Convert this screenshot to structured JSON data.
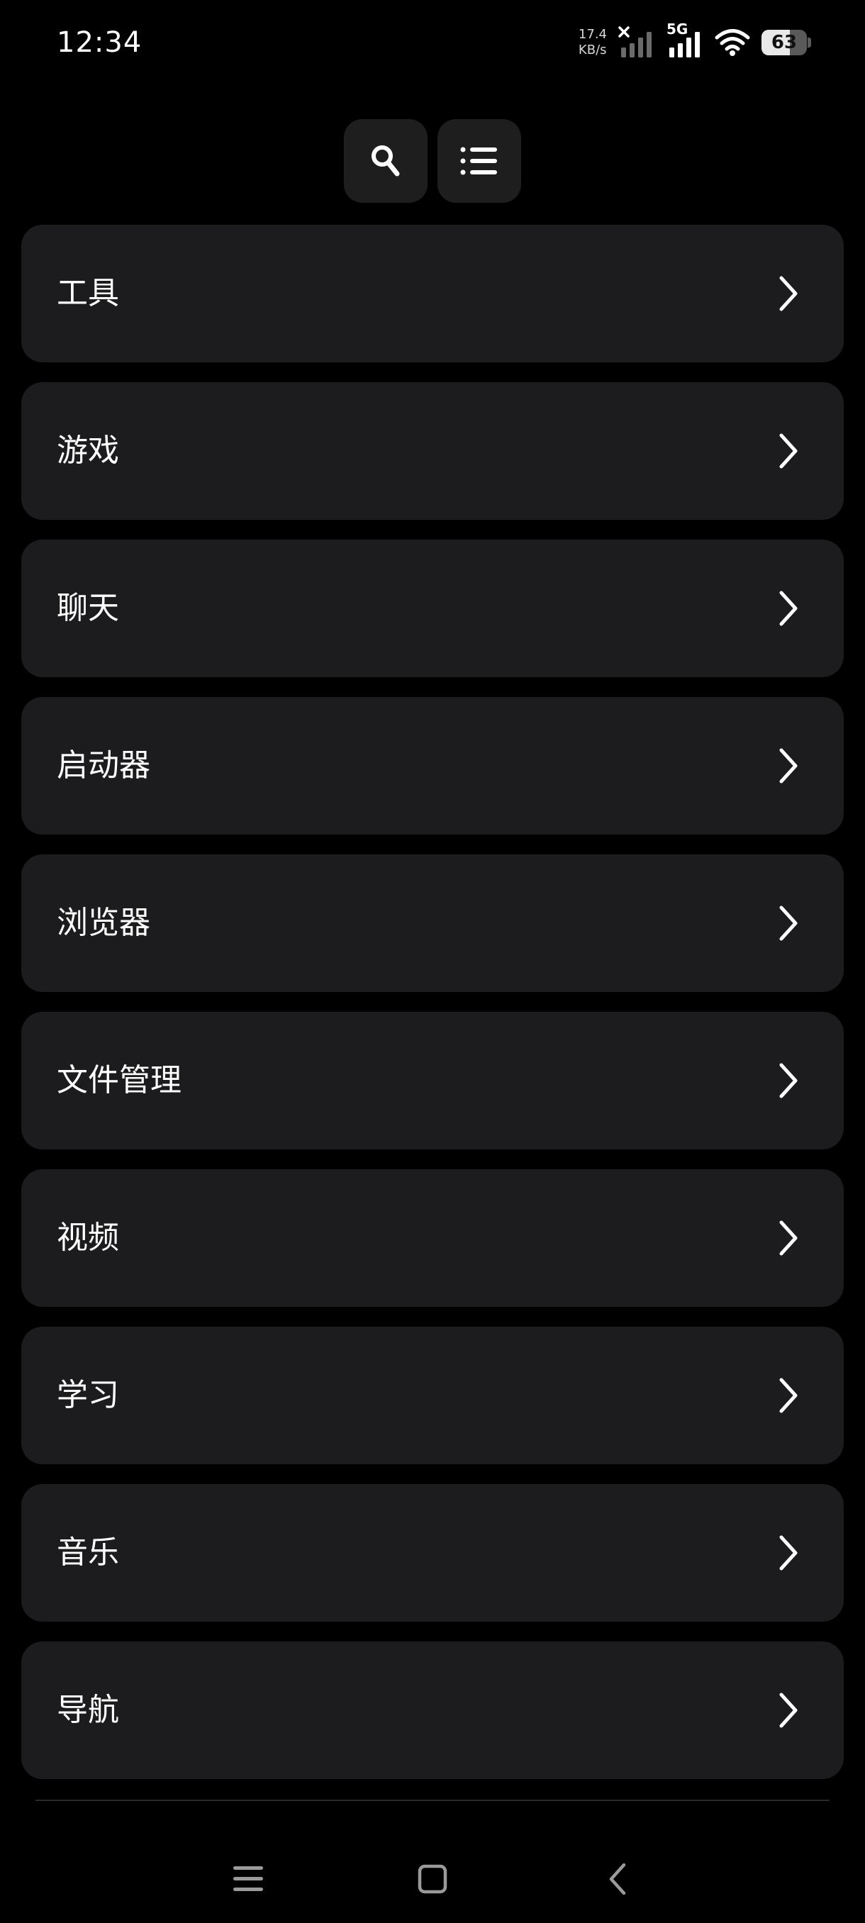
{
  "status_bar": {
    "time": "12:34",
    "net_speed_value": "17.4",
    "net_speed_unit": "KB/s",
    "network_type": "5G",
    "battery_level": "63",
    "battery_fraction": 0.63
  },
  "toolbar": {
    "search_icon": "search-icon",
    "list_icon": "list-icon"
  },
  "categories": [
    {
      "label": "工具"
    },
    {
      "label": "游戏"
    },
    {
      "label": "聊天"
    },
    {
      "label": "启动器"
    },
    {
      "label": "浏览器"
    },
    {
      "label": "文件管理"
    },
    {
      "label": "视频"
    },
    {
      "label": "学习"
    },
    {
      "label": "音乐"
    },
    {
      "label": "导航"
    }
  ],
  "nav_bar": {
    "menu_icon": "menu-icon",
    "home_icon": "home-icon",
    "back_icon": "back-icon"
  },
  "colors": {
    "background": "#000000",
    "card": "#1c1c1e",
    "button": "#1e1e1e",
    "text": "#ffffff"
  }
}
